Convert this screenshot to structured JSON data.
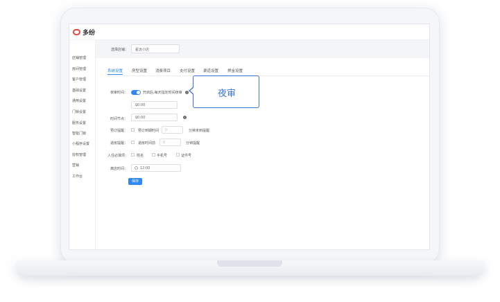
{
  "app": {
    "brand": "多纷"
  },
  "sidebar": {
    "items": [
      {
        "label": "店铺管理"
      },
      {
        "label": "房间管理"
      },
      {
        "label": "客户管理"
      },
      {
        "label": "基础设置"
      },
      {
        "label": "通用设置"
      },
      {
        "label": "门锁设置"
      },
      {
        "label": "服务设置"
      },
      {
        "label": "智能门锁"
      },
      {
        "label": "小程序设置"
      },
      {
        "label": "授权管理"
      },
      {
        "label": "营销"
      },
      {
        "label": "工作台"
      }
    ]
  },
  "store": {
    "label": "选择店铺：",
    "value": "星远小店"
  },
  "tabs": [
    {
      "label": "系统设置"
    },
    {
      "label": "房型设置"
    },
    {
      "label": "消费项目"
    },
    {
      "label": "支付设置"
    },
    {
      "label": "渠道设置"
    },
    {
      "label": "押金设置"
    }
  ],
  "form": {
    "night_audit_label": "夜审时间：",
    "night_audit_desc": "开启后,每天指定时间夜审",
    "night_audit_time": "00:00",
    "checkout_label": "时间节点：",
    "checkout_time": "00:00",
    "booking_remind_label": "预订提醒：",
    "booking_remind_check": "预订到期时间",
    "booking_remind_value": "0",
    "booking_remind_unit": "分钟未到提醒",
    "overdue_label": "退房提醒：",
    "overdue_check": "退房时间前",
    "overdue_value": "0",
    "overdue_unit": "分钟提醒",
    "required_label": "入住必填项：",
    "required_options": [
      {
        "label": "姓名"
      },
      {
        "label": "手机号"
      },
      {
        "label": "证件号"
      }
    ],
    "checkout_default_label": "离店时间：",
    "checkout_default_time": "12:00",
    "save_label": "保存"
  },
  "tooltip": {
    "text": "夜审"
  },
  "colors": {
    "accent": "#2f88f5",
    "tooltip": "#3a72d8"
  }
}
